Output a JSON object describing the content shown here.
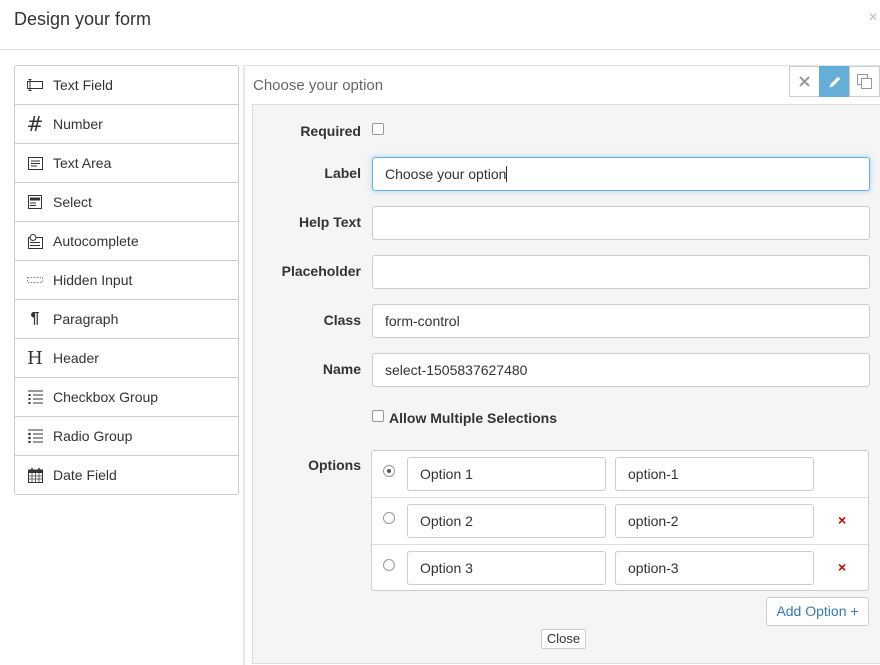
{
  "modal": {
    "title": "Design your form",
    "close_glyph": "×"
  },
  "palette": {
    "items": [
      {
        "label": "Text Field",
        "icon": "text-field-icon"
      },
      {
        "label": "Number",
        "icon": "hash-icon"
      },
      {
        "label": "Text Area",
        "icon": "text-area-icon"
      },
      {
        "label": "Select",
        "icon": "select-icon"
      },
      {
        "label": "Autocomplete",
        "icon": "autocomplete-icon"
      },
      {
        "label": "Hidden Input",
        "icon": "hidden-input-icon"
      },
      {
        "label": "Paragraph",
        "icon": "pilcrow-icon"
      },
      {
        "label": "Header",
        "icon": "header-icon"
      },
      {
        "label": "Checkbox Group",
        "icon": "checkbox-group-icon"
      },
      {
        "label": "Radio Group",
        "icon": "radio-group-icon"
      },
      {
        "label": "Date Field",
        "icon": "calendar-icon"
      }
    ]
  },
  "field": {
    "title": "Choose your option",
    "actions": {
      "remove": "close-icon",
      "edit": "pencil-icon",
      "copy": "copy-icon"
    },
    "required_label": "Required",
    "label_label": "Label",
    "label_value": "Choose your option",
    "help_text_label": "Help Text",
    "help_text_value": "",
    "placeholder_label": "Placeholder",
    "placeholder_value": "",
    "class_label": "Class",
    "class_value": "form-control",
    "name_label": "Name",
    "name_value": "select-1505837627480",
    "multiple_label": "Allow Multiple Selections",
    "options_label": "Options",
    "options": [
      {
        "label": "Option 1",
        "value": "option-1",
        "selected": true
      },
      {
        "label": "Option 2",
        "value": "option-2",
        "selected": false
      },
      {
        "label": "Option 3",
        "value": "option-3",
        "selected": false
      }
    ],
    "remove_glyph": "×",
    "add_option_label": "Add Option +",
    "close_label": "Close"
  },
  "colors": {
    "accent": "#65aed7",
    "link": "#337ab7",
    "remove": "#cc0000"
  }
}
